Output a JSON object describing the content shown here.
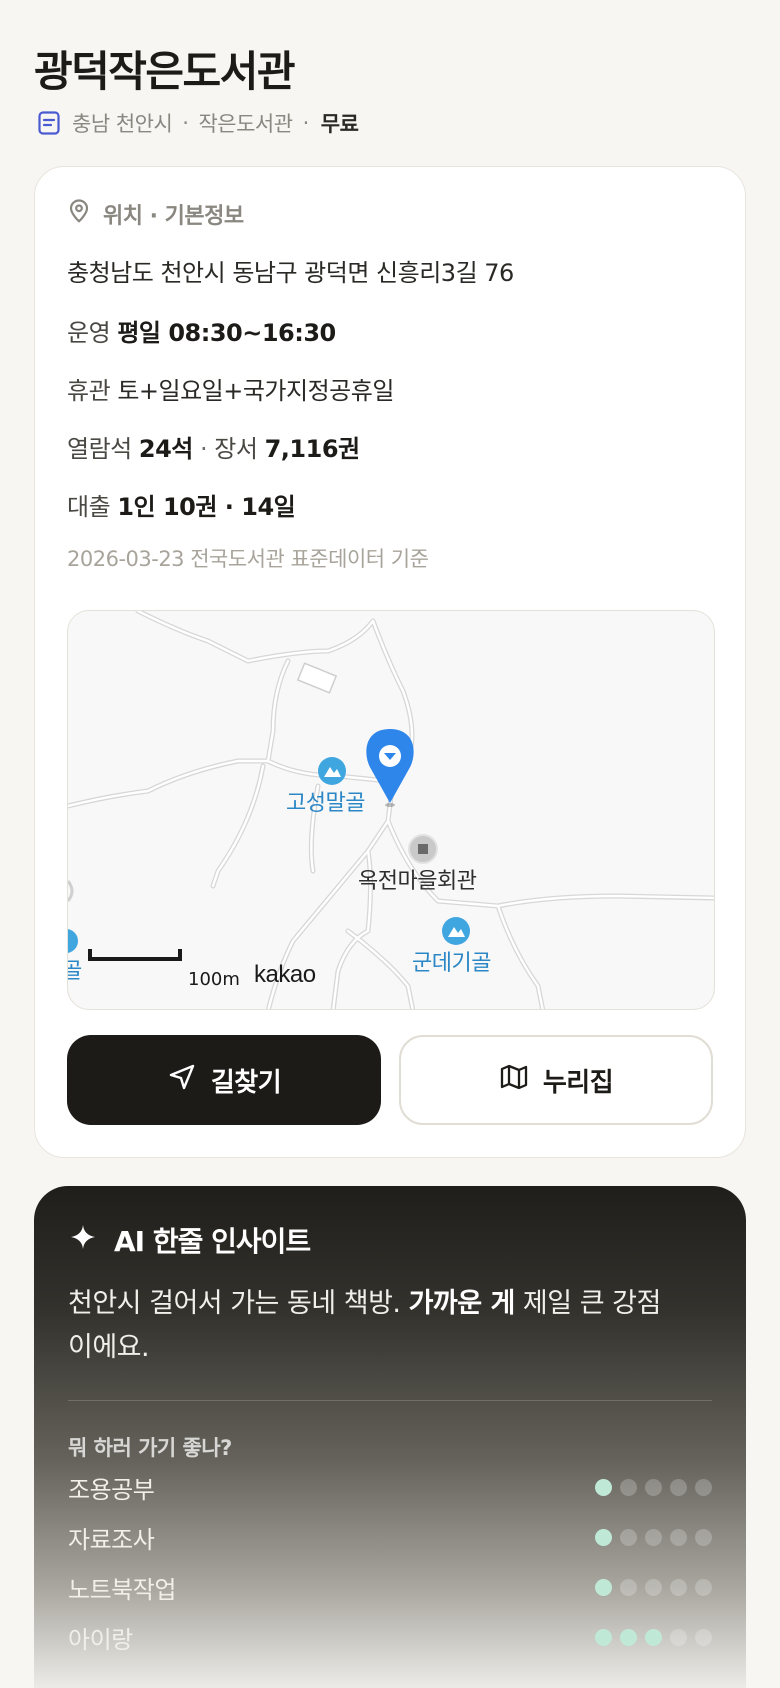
{
  "title": "광덕작은도서관",
  "subtitle": {
    "region": "충남 천안시",
    "type": "작은도서관",
    "price": "무료",
    "icon": "document-icon"
  },
  "info": {
    "section_title": "위치 · 기본정보",
    "address": "충청남도 천안시 동남구 광덕면 신흥리3길 76",
    "hours_label": "운영",
    "hours_value": "평일 08:30~16:30",
    "closed_label": "휴관",
    "closed_value": "토+일요일+국가지정공휴일",
    "seats_label": "열람석",
    "seats_value": "24석",
    "books_label": "장서",
    "books_value": "7,116권",
    "loan_label": "대출",
    "loan_value": "1인 10권 · 14일",
    "source": "2026-03-23 전국도서관 표준데이터 기준"
  },
  "map": {
    "labels": {
      "place_a": "고성말골",
      "place_b": "옥전마을회관",
      "place_c": "군데기골",
      "place_edge": "골"
    },
    "scale": "100m",
    "provider": "kakao",
    "marker_color": "#2f86ea"
  },
  "buttons": {
    "directions": "길찾기",
    "nurijip": "누리집"
  },
  "ai": {
    "heading": "AI 한줄 인사이트",
    "text_prefix": "천안시 걸어서 가는 동네 책방. ",
    "text_bold": "가까운 게",
    "text_suffix": " 제일 큰 강점이에요.",
    "question": "뭐 하러 가기 좋나?",
    "purposes": [
      {
        "label": "조용공부",
        "score": 1,
        "max": 5
      },
      {
        "label": "자료조사",
        "score": 1,
        "max": 5
      },
      {
        "label": "노트북작업",
        "score": 1,
        "max": 5
      },
      {
        "label": "아이랑",
        "score": 3,
        "max": 5
      }
    ]
  },
  "colors": {
    "background": "#f7f6f2",
    "dark": "#1c1b18",
    "muted": "#8a8780",
    "rating_on": "#bfe9d6"
  }
}
